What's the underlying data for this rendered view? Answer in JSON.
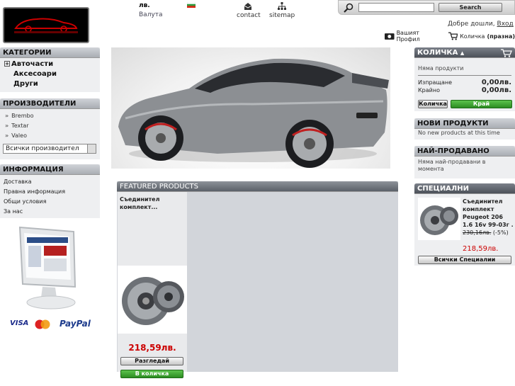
{
  "header": {
    "currency_code": "лв.",
    "currency_label": "Валута",
    "contact_label": "contact",
    "sitemap_label": "sitemap",
    "search_button": "Search",
    "welcome_text": "Добре дошли,",
    "login_link": "Вход",
    "profile_label": "Вашият Профил",
    "cart_label": "Количка",
    "cart_status": "(празна)"
  },
  "categories": {
    "title": "КАТЕГОРИИ",
    "items": [
      "Авточасти",
      "Аксесоари",
      "Други"
    ]
  },
  "manufacturers": {
    "title": "ПРОИЗВОДИТЕЛИ",
    "items": [
      "Brembo",
      "Textar",
      "Valeo"
    ],
    "select_value": "Всички производител"
  },
  "information": {
    "title": "ИНФОРМАЦИЯ",
    "items": [
      "Доставка",
      "Правна информация",
      "Общи условия",
      "За нас"
    ]
  },
  "payments": {
    "visa": "VISA",
    "paypal": "PayPal"
  },
  "cart_box": {
    "title": "КОЛИЧКА",
    "empty_text": "Няма продукти",
    "shipping_label": "Изпращане",
    "shipping_value": "0,00лв.",
    "total_label": "Крайно",
    "total_value": "0,00лв.",
    "cart_button": "Количка",
    "checkout_button": "Край"
  },
  "new_products": {
    "title": "НОВИ ПРОДУКТИ",
    "text": "No new products at this time"
  },
  "bestsellers": {
    "title": "НАЙ-ПРОДАВАНО",
    "text": "Няма най-продавани в момента"
  },
  "specials": {
    "title": "СПЕЦИАЛНИ",
    "product_name": "Съединител комплект Peugeot 206 1.6 16v 99-03г .",
    "old_price": "230,16лв.",
    "discount": "(-5%)",
    "new_price": "218,59лв.",
    "all_button": "Всички Специалии"
  },
  "featured": {
    "title": "FEATURED PRODUCTS",
    "product_name": "Съединител комплект...",
    "price": "218,59лв.",
    "view_button": "Разгледай",
    "cart_button": "В количка"
  },
  "colors": {
    "accent_green": "#2c8c22",
    "price_red": "#cc0000",
    "panel_dark": "#4c5159"
  }
}
